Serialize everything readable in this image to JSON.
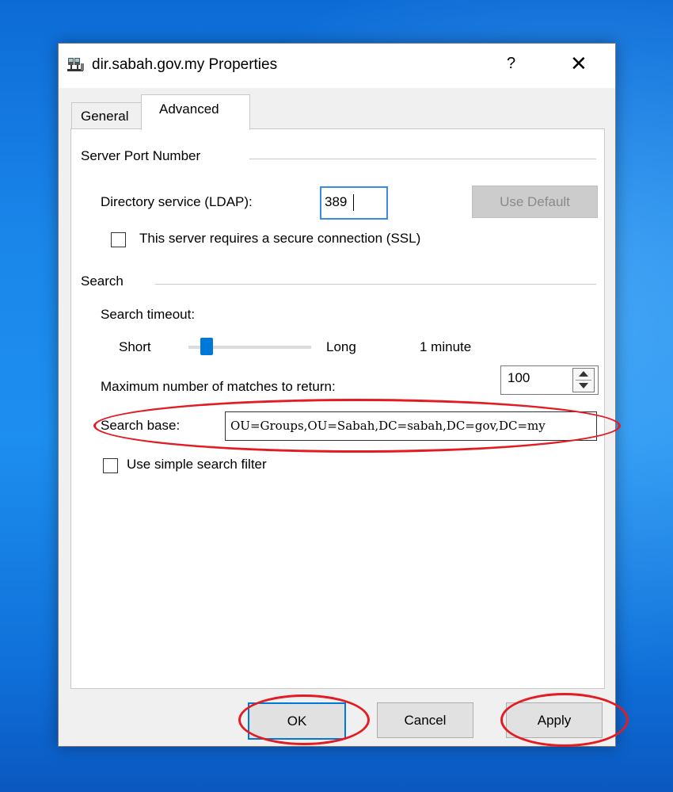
{
  "window": {
    "title": "dir.sabah.gov.my Properties",
    "help_label": "?",
    "close_label": "✕",
    "icon": "directory-service-icon"
  },
  "tabs": [
    {
      "label": "General",
      "active": false
    },
    {
      "label": "Advanced",
      "active": true
    }
  ],
  "server_port": {
    "group_label": "Server Port Number",
    "ldap_label": "Directory service (LDAP):",
    "ldap_value": "389",
    "use_default_label": "Use Default",
    "ssl_label": "This server requires a secure connection (SSL)",
    "ssl_checked": false
  },
  "search": {
    "group_label": "Search",
    "timeout_label": "Search timeout:",
    "slider_min_label": "Short",
    "slider_max_label": "Long",
    "timeout_value": "1 minute",
    "slider_level": 0.15,
    "max_matches_label": "Maximum number of matches to return:",
    "max_matches_value": "100",
    "search_base_label": "Search base:",
    "search_base_value": "OU=Groups,OU=Sabah,DC=sabah,DC=gov,DC=my",
    "simple_filter_label": "Use simple search filter",
    "simple_filter_checked": false
  },
  "buttons": {
    "ok": "OK",
    "cancel": "Cancel",
    "apply": "Apply"
  },
  "colors": {
    "accent": "#0078d7",
    "highlight_ring": "#e31b23"
  }
}
